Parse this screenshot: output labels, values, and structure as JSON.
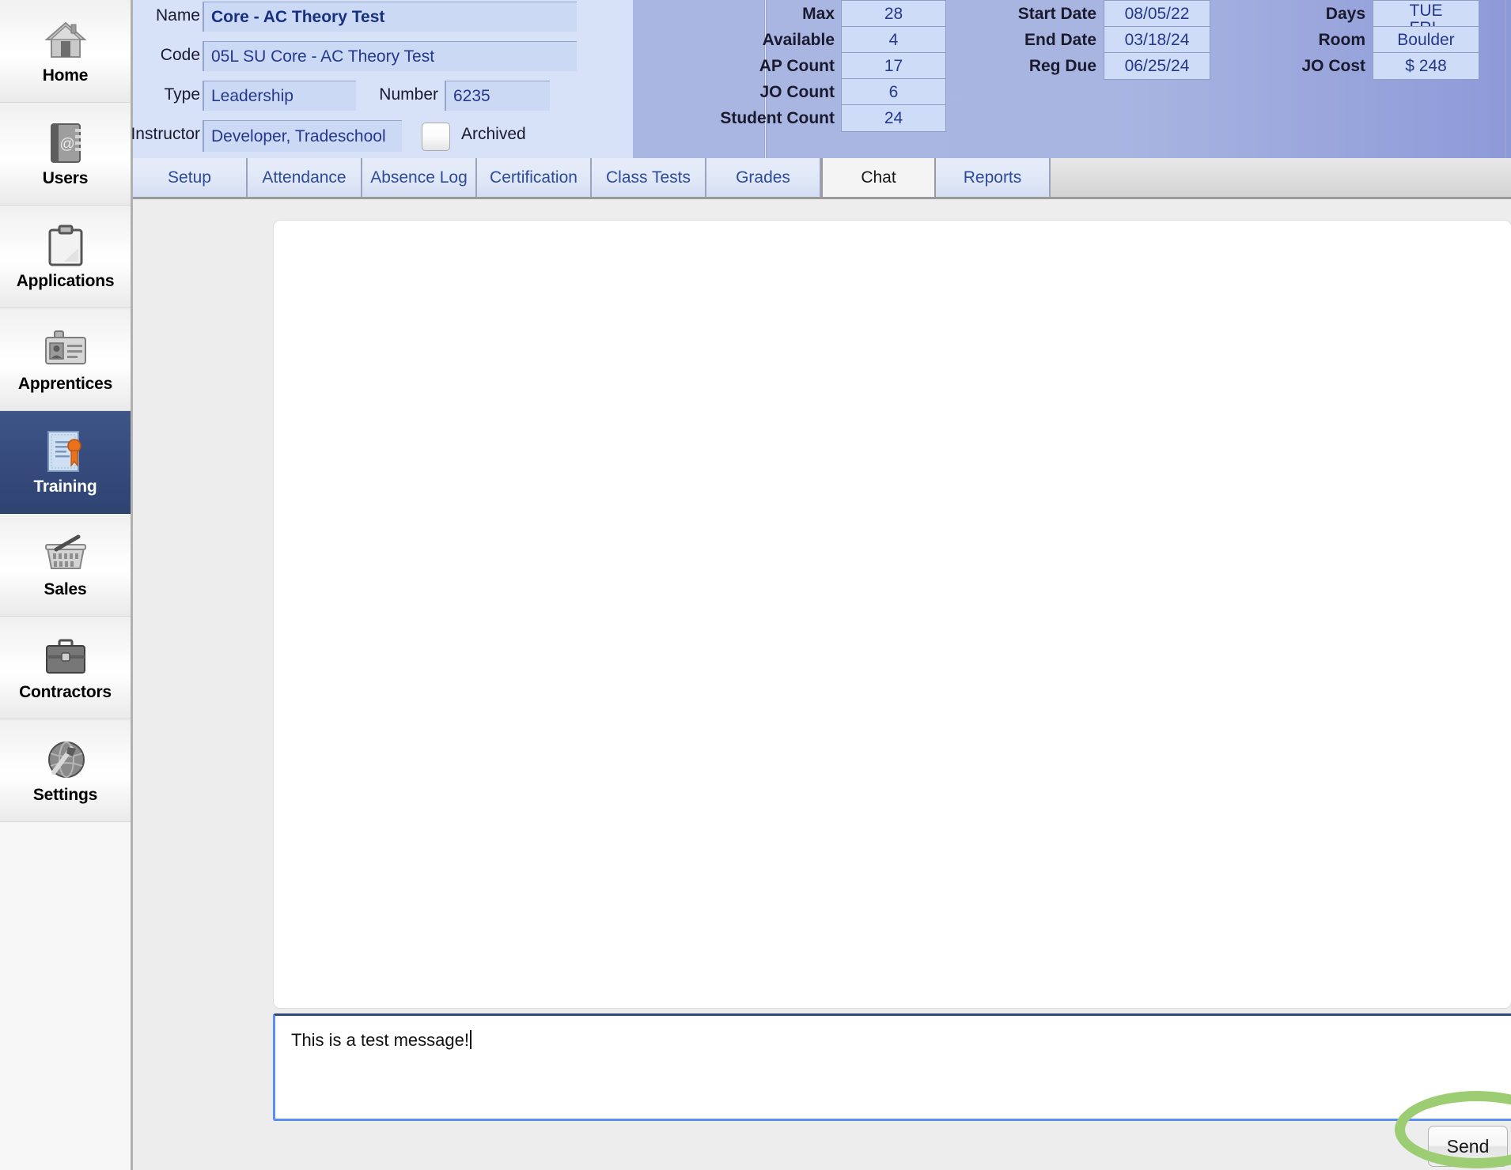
{
  "sidebar": {
    "items": [
      {
        "label": "Home",
        "icon": "house-icon",
        "active": false
      },
      {
        "label": "Users",
        "icon": "address-book-icon",
        "active": false
      },
      {
        "label": "Applications",
        "icon": "clipboard-icon",
        "active": false
      },
      {
        "label": "Apprentices",
        "icon": "id-badge-icon",
        "active": false
      },
      {
        "label": "Training",
        "icon": "certificate-icon",
        "active": true
      },
      {
        "label": "Sales",
        "icon": "shopping-basket-icon",
        "active": false
      },
      {
        "label": "Contractors",
        "icon": "briefcase-icon",
        "active": false
      },
      {
        "label": "Settings",
        "icon": "globe-wrench-icon",
        "active": false
      }
    ]
  },
  "header": {
    "fields": {
      "name_label": "Name",
      "name_value": "Core - AC Theory Test",
      "code_label": "Code",
      "code_value": "05L SU Core - AC Theory Test",
      "type_label": "Type",
      "type_value": "Leadership",
      "number_label": "Number",
      "number_value": "6235",
      "instructor_label": "Instructor",
      "instructor_value": "Developer, Tradeschool",
      "archived_label": "Archived",
      "archived_checked": false
    },
    "counts": [
      {
        "label": "Max",
        "value": "28"
      },
      {
        "label": "Available",
        "value": "4"
      },
      {
        "label": "AP Count",
        "value": "17"
      },
      {
        "label": "JO Count",
        "value": "6"
      },
      {
        "label": "Student Count",
        "value": "24"
      }
    ],
    "dates": [
      {
        "label": "Start Date",
        "value": "08/05/22"
      },
      {
        "label": "End Date",
        "value": "03/18/24"
      },
      {
        "label": "Reg Due",
        "value": "06/25/24"
      }
    ],
    "schedule": [
      {
        "label": "Days",
        "value": "TUE\nFRI"
      },
      {
        "label": "Room",
        "value": "Boulder"
      },
      {
        "label": "JO Cost",
        "value": "$ 248"
      }
    ]
  },
  "tabs": [
    {
      "label": "Setup",
      "active": false
    },
    {
      "label": "Attendance",
      "active": false
    },
    {
      "label": "Absence Log",
      "active": false
    },
    {
      "label": "Certification",
      "active": false
    },
    {
      "label": "Class Tests",
      "active": false
    },
    {
      "label": "Grades",
      "active": false
    },
    {
      "label": "Chat",
      "active": true
    },
    {
      "label": "Reports",
      "active": false
    }
  ],
  "chat": {
    "messages": [],
    "compose_value": "This is a test message!",
    "compose_placeholder": "",
    "send_label": "Send"
  },
  "annotation": {
    "shape": "ellipse",
    "color": "#9ccd72",
    "target": "send-button"
  }
}
